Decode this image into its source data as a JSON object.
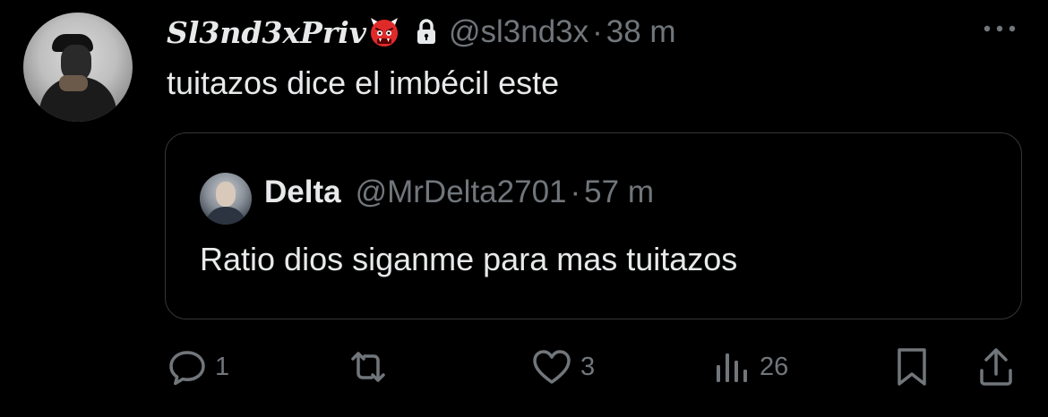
{
  "post": {
    "display_name": "Sl3nd3xPriv",
    "name_emoji": "ogre-emoji",
    "protected_icon": "lock-icon",
    "handle": "@sl3nd3x",
    "separator": "·",
    "time": "38 m",
    "more_icon": "more-horizontal-icon",
    "text": "tuitazos dice el imbécil este"
  },
  "quoted": {
    "display_name": "Delta",
    "handle": "@MrDelta2701",
    "separator": "·",
    "time": "57 m",
    "text": "Ratio dios siganme para mas tuitazos"
  },
  "actions": {
    "reply": {
      "icon": "reply-icon",
      "count": "1"
    },
    "repost": {
      "icon": "repost-icon",
      "count": ""
    },
    "like": {
      "icon": "heart-icon",
      "count": "3"
    },
    "views": {
      "icon": "views-icon",
      "count": "26"
    },
    "bookmark": {
      "icon": "bookmark-icon"
    },
    "share": {
      "icon": "share-icon"
    }
  },
  "colors": {
    "background": "#000000",
    "primary_text": "#e7e9ea",
    "secondary_text": "#71767b",
    "border": "#333639",
    "emoji_red": "#e02a2a"
  }
}
